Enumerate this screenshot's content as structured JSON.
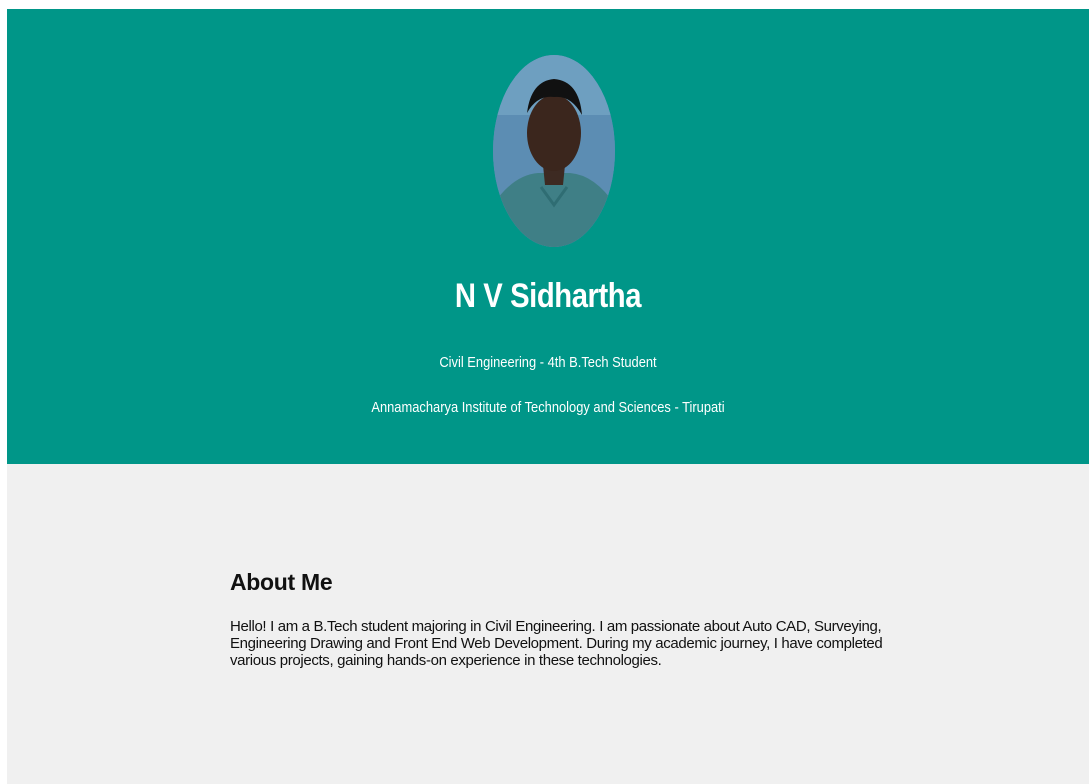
{
  "header": {
    "avatar_icon": "profile-photo",
    "name": "N V Sidhartha",
    "subtitle_line1": "Civil Engineering - 4th B.Tech Student",
    "subtitle_line2": "Annamacharya Institute of Technology and Sciences - Tirupati",
    "background_color": "#009688"
  },
  "about": {
    "title": "About Me",
    "text": "Hello! I am a B.Tech student majoring in Civil Engineering. I am passionate about Auto CAD, Surveying, Engineering Drawing and Front End Web Development. During my academic journey, I have completed various projects, gaining hands-on experience in these technologies."
  }
}
